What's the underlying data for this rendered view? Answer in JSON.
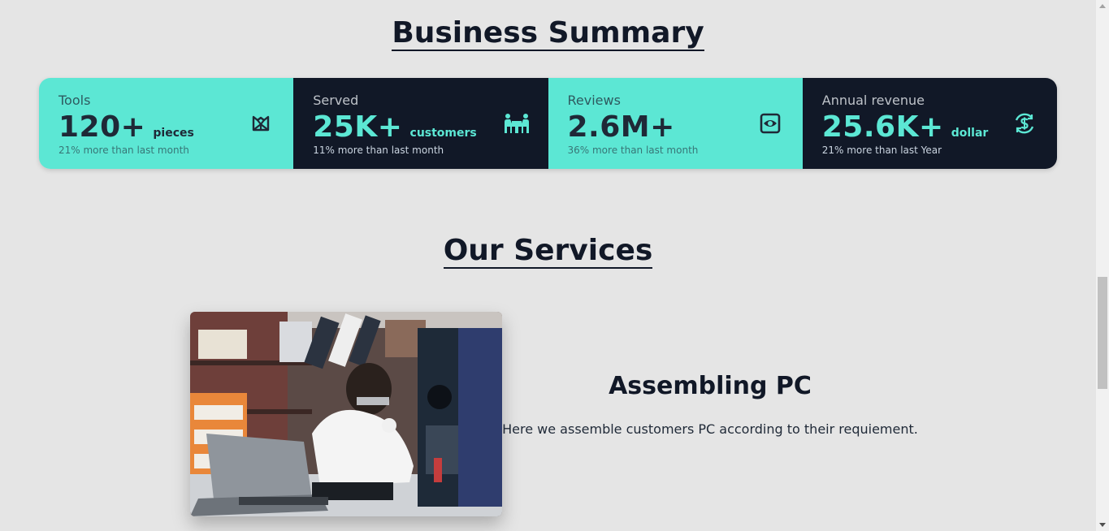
{
  "business_summary": {
    "title": "Business Summary",
    "stats": [
      {
        "label": "Tools",
        "value": "120+",
        "unit": "pieces",
        "desc": "21% more than last month",
        "icon": "box-icon",
        "theme": "light"
      },
      {
        "label": "Served",
        "value": "25K+",
        "unit": "customers",
        "desc": "11% more than last month",
        "icon": "people-meeting-icon",
        "theme": "dark"
      },
      {
        "label": "Reviews",
        "value": "2.6M+",
        "unit": "",
        "desc": "36% more than last month",
        "icon": "eye-icon",
        "theme": "light"
      },
      {
        "label": "Annual revenue",
        "value": "25.6K+",
        "unit": "dollar",
        "desc": "21% more than last Year",
        "icon": "dollar-sync-icon",
        "theme": "dark"
      }
    ]
  },
  "services": {
    "title": "Our Services",
    "items": [
      {
        "title": "Assembling PC",
        "description": "Here we assemble customers PC according to their requiement."
      }
    ]
  },
  "colors": {
    "accent": "#5ce7d4",
    "dark": "#111827",
    "background": "#e5e5e5"
  }
}
